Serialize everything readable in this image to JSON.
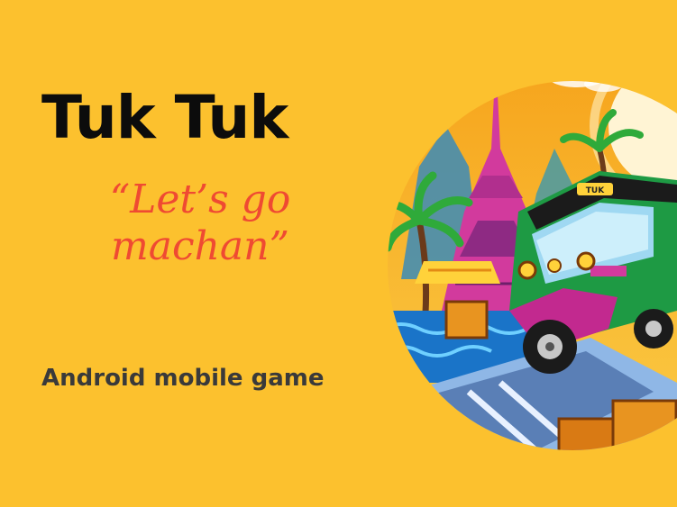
{
  "page": {
    "title": "Tuk Tuk",
    "tagline": "“Let’s go machan”",
    "subtitle": "Android mobile game",
    "background_color": "#fcc12e",
    "tagline_color": "#ef4a32"
  },
  "illustration": {
    "icon": "tuk-tuk-illustration",
    "vehicle_sign": "TUK"
  }
}
